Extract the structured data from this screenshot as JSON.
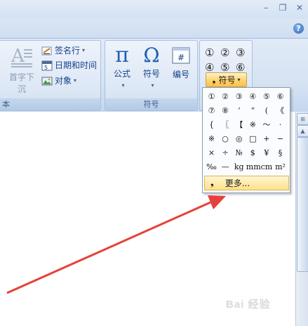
{
  "ribbon": {
    "text_group": {
      "label": "本",
      "drop_cap_label": "首字下沉",
      "signature_line_label": "签名行",
      "date_time_label": "日期和时间",
      "object_label": "对象"
    },
    "symbols_group": {
      "label": "符号",
      "equation_label": "公式",
      "symbol_label": "符号",
      "number_label": "编号"
    },
    "special_symbols_group": {
      "row1": [
        "①",
        "②",
        "③"
      ],
      "row2": [
        "④",
        "⑤",
        "⑥"
      ],
      "symbol_button_label": "符号"
    }
  },
  "symbol_panel": {
    "rows": [
      [
        "①",
        "②",
        "③",
        "④",
        "⑤",
        "⑥"
      ],
      [
        "⑦",
        "⑧",
        "‘",
        "“",
        "(",
        "《"
      ],
      [
        "{",
        "〖",
        "【",
        "※",
        "～",
        "·"
      ],
      [
        "※",
        "○",
        "◎",
        "□",
        "+",
        "−"
      ],
      [
        "×",
        "÷",
        "№",
        "$",
        "¥",
        "§"
      ],
      [
        "‰",
        "—",
        "kg",
        "mm",
        "cm",
        "m²"
      ]
    ],
    "more_label": "更多..."
  },
  "watermark": "Bai 经验",
  "colors": {
    "arrow": "#e8403a",
    "highlight": "#ffd36b"
  }
}
